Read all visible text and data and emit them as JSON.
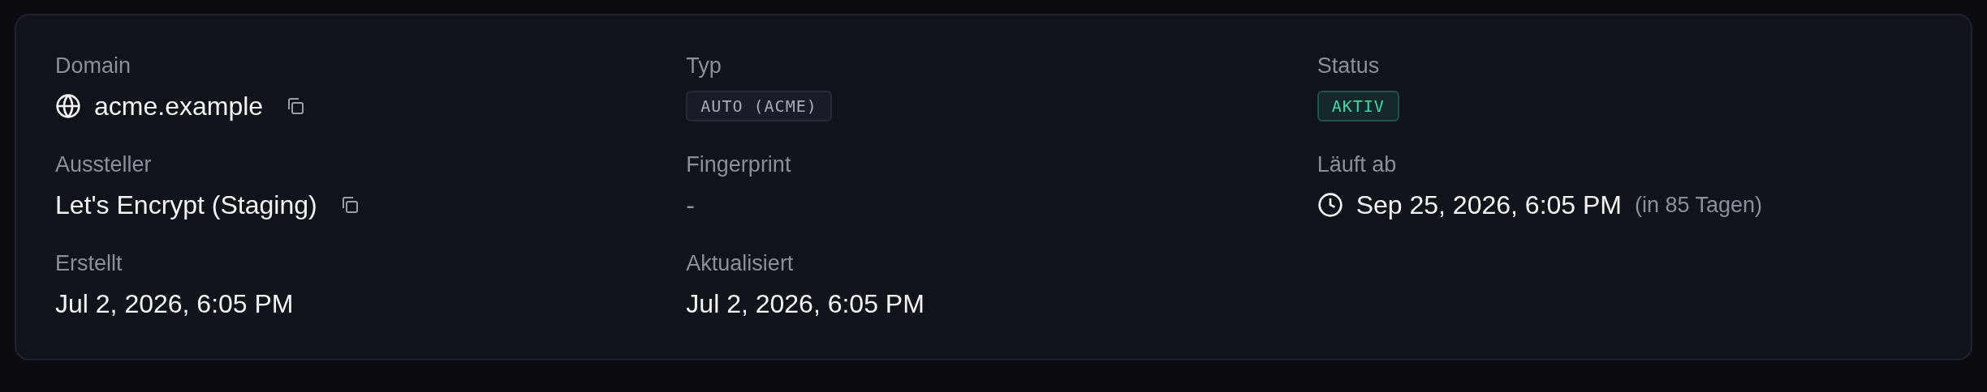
{
  "fields": [
    {
      "label": "Domain",
      "kind": "domain",
      "value": "acme.example",
      "copyable": true
    },
    {
      "label": "Typ",
      "kind": "code-tag",
      "value": "AUTO (ACME)"
    },
    {
      "label": "Status",
      "kind": "status-tag",
      "value": "AKTIV"
    },
    {
      "label": "Aussteller",
      "kind": "text",
      "value": "Let's Encrypt (Staging)",
      "copyable": true
    },
    {
      "label": "Fingerprint",
      "kind": "muted-text",
      "value": "-"
    },
    {
      "label": "Läuft ab",
      "kind": "expiry",
      "value": "Sep 25, 2026, 6:05 PM",
      "note": "(in 85 Tagen)"
    },
    {
      "label": "Erstellt",
      "kind": "text",
      "value": "Jul 2, 2026, 6:05 PM"
    },
    {
      "label": "Aktualisiert",
      "kind": "text",
      "value": "Jul 2, 2026, 6:05 PM"
    }
  ]
}
